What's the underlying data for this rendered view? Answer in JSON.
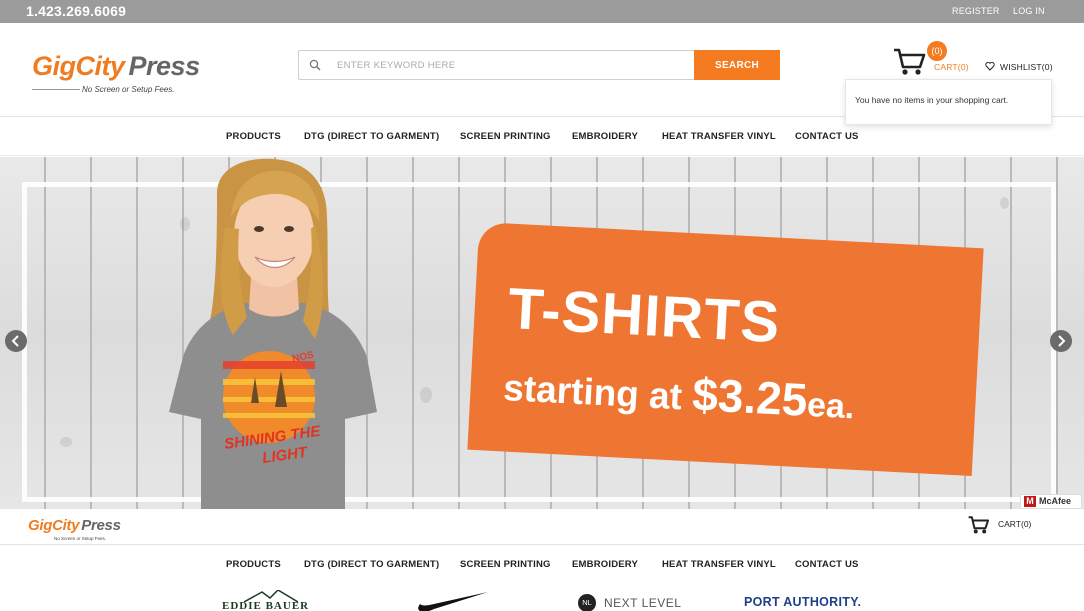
{
  "topbar": {
    "phone": "1.423.269.6069",
    "register": "REGISTER",
    "login": "LOG IN"
  },
  "header": {
    "logo_part1": "GigCity",
    "logo_part2": "Press",
    "tagline": "No Screen or Setup Fees.",
    "search": {
      "placeholder": "ENTER KEYWORD HERE",
      "button": "SEARCH"
    },
    "cart_count": "(0)",
    "cart_label": "CART(0)",
    "wishlist_label": "WISHLIST(0)",
    "cart_dropdown_text": "You have no items in your shopping cart."
  },
  "nav": {
    "items": [
      "PRODUCTS",
      "DTG (DIRECT TO GARMENT)",
      "SCREEN PRINTING",
      "EMBROIDERY",
      "HEAT TRANSFER VINYL",
      "CONTACT US"
    ]
  },
  "hero": {
    "title": "T-SHIRTS",
    "subtitle_prefix": "starting at ",
    "price": "$3.25",
    "unit": "ea.",
    "shirt_text_1": "SHINING THE",
    "shirt_text_2": "LIGHT",
    "shirt_text_top": "NOS"
  },
  "sticky": {
    "logo_part1": "GigCity",
    "logo_part2": "Press",
    "tagline": "No Screen or Setup Fees.",
    "cart_label": "CART(0)"
  },
  "badge": {
    "mcafee": "McAfee"
  },
  "brands": {
    "eddie": "EDDIE BAUER",
    "next_level_mark": "NL",
    "next_level": "NEXT LEVEL",
    "port_authority": "PORT AUTHORITY."
  },
  "colors": {
    "accent": "#f47b20",
    "topbar": "#9b9b9b",
    "promo": "#ef7533"
  }
}
